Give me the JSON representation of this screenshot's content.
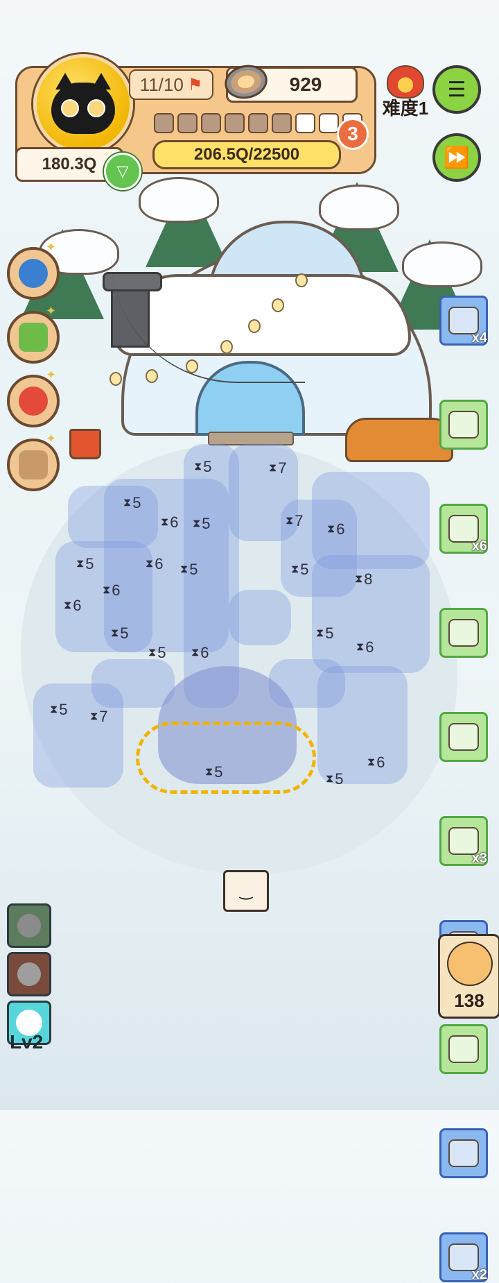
{
  "hud": {
    "stage": "11/10",
    "coins": "929",
    "progress_total": 9,
    "progress_filled": 6,
    "level_badge": "3",
    "goal": "206.5Q/22500",
    "money": "180.3Q",
    "difficulty": "难度1"
  },
  "buttons": {
    "menu_icon": "menu-list-icon",
    "fast_forward_icon": "fast-forward-icon"
  },
  "left_tools": [
    {
      "name": "joystick",
      "icon": "joystick-icon"
    },
    {
      "name": "medical-kit",
      "icon": "medkit-icon"
    },
    {
      "name": "daruma",
      "icon": "daruma-icon"
    },
    {
      "name": "box",
      "icon": "open-box-icon"
    }
  ],
  "right_cards": [
    {
      "style": "blue",
      "icon": "fireplace-icon",
      "count": "x4"
    },
    {
      "style": "green",
      "icon": "snow-globe-icon",
      "count": ""
    },
    {
      "style": "green",
      "icon": "hot-tea-icon",
      "count": "x6"
    },
    {
      "style": "green",
      "icon": "credit-card-icon",
      "count": ""
    },
    {
      "style": "green",
      "icon": "ticket-icon",
      "count": ""
    },
    {
      "style": "green",
      "icon": "coupon-icon",
      "count": "x3"
    },
    {
      "style": "blue",
      "icon": "toy-mouse-icon",
      "count": ""
    },
    {
      "style": "green",
      "icon": "snow-globe-icon",
      "count": ""
    },
    {
      "style": "blue",
      "icon": "discount-card-icon",
      "count": ""
    },
    {
      "style": "blue",
      "icon": "amulet-icon",
      "count": "x2"
    }
  ],
  "timers": [
    {
      "n": "5"
    },
    {
      "n": "7"
    },
    {
      "n": "5"
    },
    {
      "n": "6"
    },
    {
      "n": "5"
    },
    {
      "n": "7"
    },
    {
      "n": "6"
    },
    {
      "n": "5"
    },
    {
      "n": "6"
    },
    {
      "n": "6"
    },
    {
      "n": "5"
    },
    {
      "n": "5"
    },
    {
      "n": "8"
    },
    {
      "n": "6"
    },
    {
      "n": "5"
    },
    {
      "n": "5"
    },
    {
      "n": "6"
    },
    {
      "n": "5"
    },
    {
      "n": "6"
    },
    {
      "n": "5"
    },
    {
      "n": "7"
    },
    {
      "n": "5"
    },
    {
      "n": "5"
    },
    {
      "n": "6"
    }
  ],
  "bottom": {
    "level": "Lv2",
    "guest_count": "138",
    "collapse_icon": "collapse-icon"
  },
  "colors": {
    "accent": "#f6c78a",
    "green_button": "#8bd343",
    "goal_bar": "#ffe068"
  }
}
